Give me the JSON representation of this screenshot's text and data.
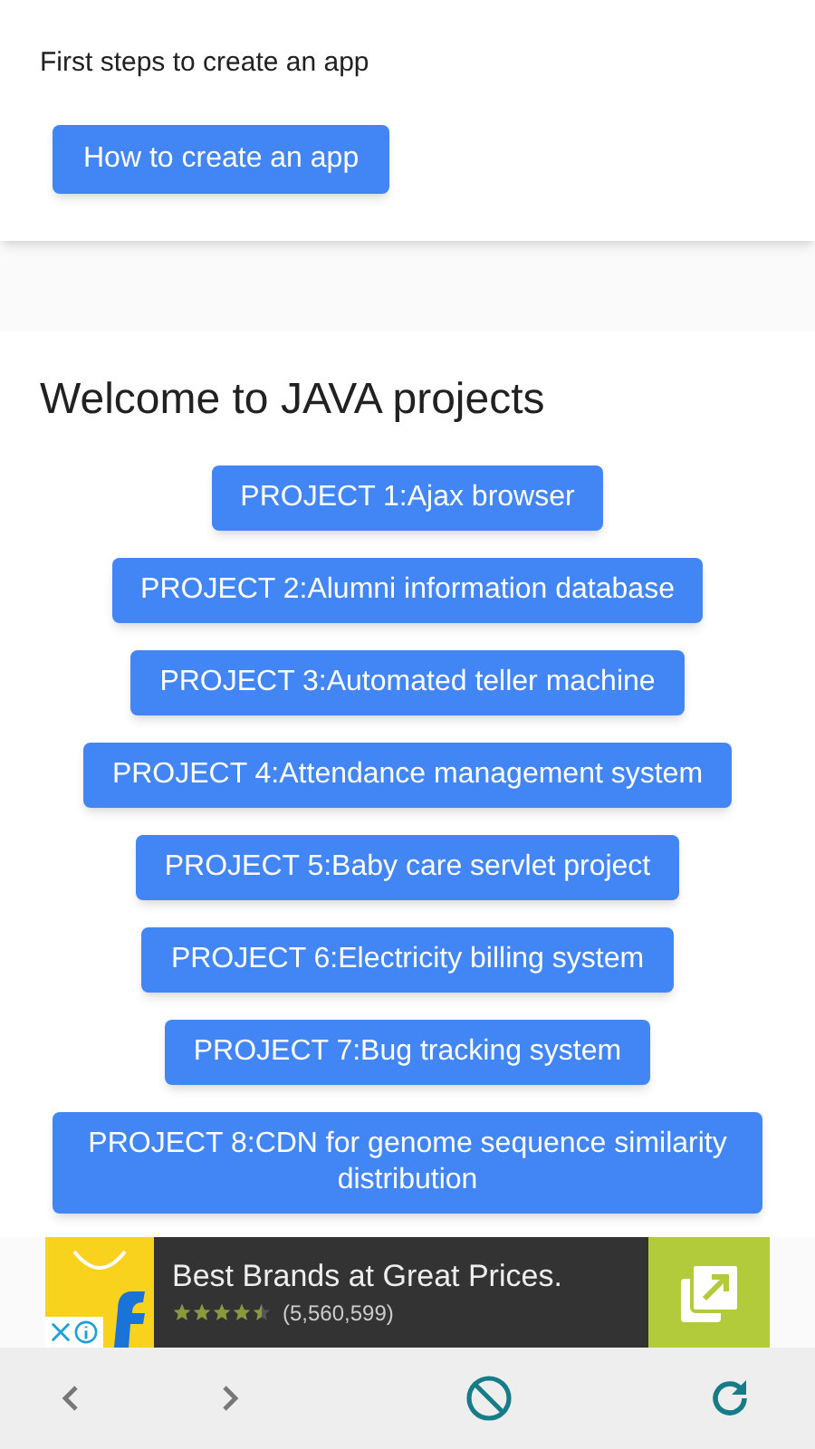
{
  "intro": {
    "text": "First steps to create an app",
    "button": "How to create an app"
  },
  "projects": {
    "title": "Welcome to JAVA projects",
    "buttons": [
      "PROJECT 1:Ajax browser",
      "PROJECT 2:Alumni information database",
      "PROJECT 3:Automated teller machine",
      "PROJECT 4:Attendance management system",
      "PROJECT 5:Baby care servlet project",
      "PROJECT 6:Electricity billing system",
      "PROJECT 7:Bug tracking system",
      "PROJECT 8:CDN for genome sequence similarity distribution"
    ]
  },
  "ad": {
    "headline": "Best Brands at Great Prices.",
    "stars": 4.5,
    "reviews": "(5,560,599)"
  }
}
